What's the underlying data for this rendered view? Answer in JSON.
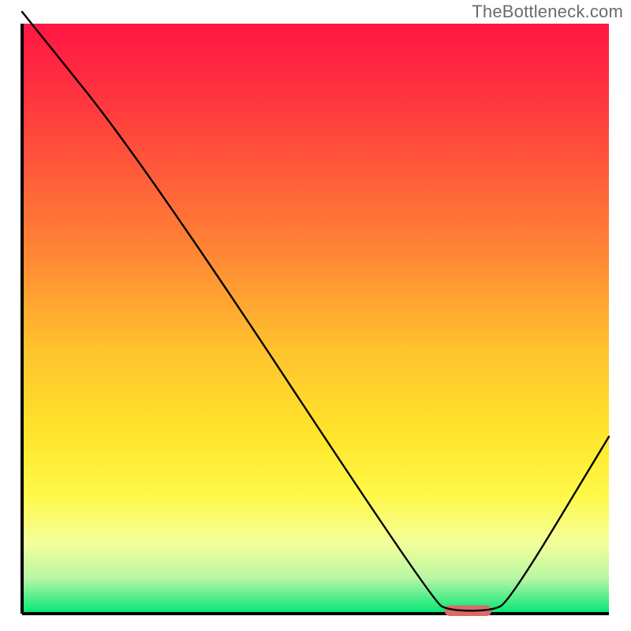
{
  "watermark": "TheBottleneck.com",
  "chart_data": {
    "type": "line",
    "title": "",
    "xlabel": "",
    "ylabel": "",
    "xlim": [
      0,
      100
    ],
    "ylim": [
      0,
      100
    ],
    "x_axis_visible": true,
    "y_ticks_visible": false,
    "x_ticks_visible": false,
    "background_gradient": {
      "stops": [
        {
          "offset": 0.0,
          "color": "#ff1744"
        },
        {
          "offset": 0.1,
          "color": "#ff2e3f"
        },
        {
          "offset": 0.25,
          "color": "#ff5a3a"
        },
        {
          "offset": 0.4,
          "color": "#ff8a34"
        },
        {
          "offset": 0.55,
          "color": "#ffc22e"
        },
        {
          "offset": 0.7,
          "color": "#ffe62b"
        },
        {
          "offset": 0.8,
          "color": "#fff94a"
        },
        {
          "offset": 0.88,
          "color": "#f4ff9a"
        },
        {
          "offset": 0.94,
          "color": "#b8f7a4"
        },
        {
          "offset": 1.0,
          "color": "#00e676"
        }
      ]
    },
    "series": [
      {
        "name": "bottleneck-curve",
        "color": "#000000",
        "width": 2.4,
        "points": [
          {
            "x": 0,
            "y": 102
          },
          {
            "x": 21,
            "y": 76
          },
          {
            "x": 70,
            "y": 2
          },
          {
            "x": 73,
            "y": 0.5
          },
          {
            "x": 80,
            "y": 0.5
          },
          {
            "x": 83,
            "y": 2
          },
          {
            "x": 100,
            "y": 30
          }
        ]
      }
    ],
    "markers": [
      {
        "name": "optimal-range",
        "shape": "capsule",
        "color": "#d96a6a",
        "x_start": 72,
        "x_end": 80,
        "y": 0.5,
        "height_pct": 1.8
      }
    ]
  }
}
